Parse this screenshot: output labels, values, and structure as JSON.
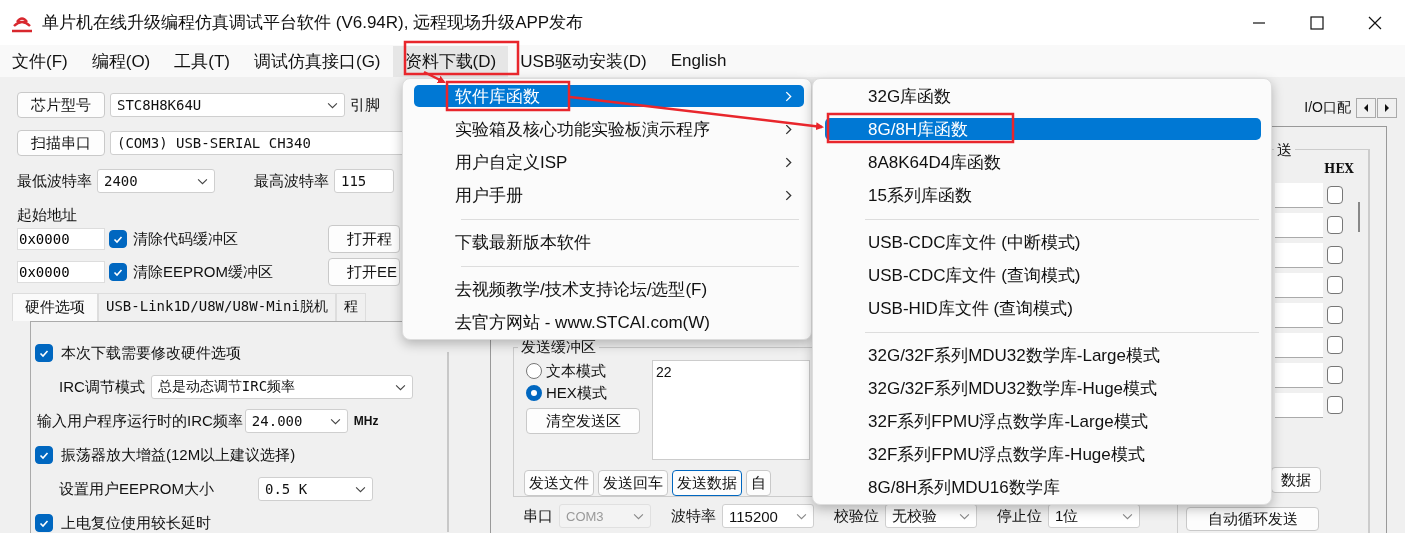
{
  "window": {
    "title": "单片机在线升级编程仿真调试平台软件 (V6.94R), 远程现场升级APP发布"
  },
  "menu_bar": [
    {
      "label": "文件(F)",
      "selected": false
    },
    {
      "label": "编程(O)",
      "selected": false
    },
    {
      "label": "工具(T)",
      "selected": false
    },
    {
      "label": "调试仿真接口(G)",
      "selected": false
    },
    {
      "label": "资料下载(D)",
      "selected": true
    },
    {
      "label": "USB驱动安装(D)",
      "selected": false
    },
    {
      "label": "English",
      "selected": false
    }
  ],
  "chip": {
    "button": "芯片型号",
    "value": "STC8H8K64U",
    "pin_label": "引脚"
  },
  "port": {
    "button": "扫描串口",
    "value": "(COM3) USB-SERIAL CH340"
  },
  "baud": {
    "min_label": "最低波特率",
    "min_value": "2400",
    "max_label": "最高波特率",
    "max_value": "115"
  },
  "start_address": {
    "label": "起始地址",
    "rows": [
      {
        "value": "0x0000",
        "checkbox": "清除代码缓冲区",
        "checked": true,
        "button": "打开程"
      },
      {
        "value": "0x0000",
        "checkbox": "清除EEPROM缓冲区",
        "checked": true,
        "button": "打开EE"
      }
    ]
  },
  "option_tabs": [
    {
      "label": "硬件选项",
      "selected": true
    },
    {
      "label": "USB-Link1D/U8W/U8W-Mini脱机",
      "selected": false
    },
    {
      "label": "程",
      "selected": false
    }
  ],
  "hardware_options": [
    {
      "kind": "checkbox",
      "label": "本次下载需要修改硬件选项",
      "checked": true
    },
    {
      "kind": "select",
      "label": "IRC调节模式",
      "value": "总是动态调节IRC频率"
    },
    {
      "kind": "select",
      "label": "输入用户程序运行时的IRC频率",
      "value": "24.000",
      "unit": "MHz"
    },
    {
      "kind": "checkbox",
      "label": "振荡器放大增益(12M以上建议选择)",
      "checked": true
    },
    {
      "kind": "select",
      "label": "设置用户EEPROM大小",
      "value": "0.5 K"
    },
    {
      "kind": "checkbox",
      "label": "上电复位使用较长延时",
      "checked": true
    }
  ],
  "right_tabs": [
    {
      "label": "I/O口配"
    }
  ],
  "send_buffer": {
    "title": "发送缓冲区",
    "modes": [
      {
        "label": "文本模式",
        "selected": false
      },
      {
        "label": "HEX模式",
        "selected": true
      }
    ],
    "clear_button": "清空发送区",
    "content": "22",
    "buttons": [
      {
        "label": "发送文件",
        "focused": false
      },
      {
        "label": "发送回车",
        "focused": false
      },
      {
        "label": "发送数据",
        "focused": true
      },
      {
        "label": "自",
        "focused": false
      }
    ]
  },
  "serial_settings": [
    {
      "label": "串口",
      "value": "COM3",
      "disabled": true
    },
    {
      "label": "波特率",
      "value": "115200",
      "disabled": false
    },
    {
      "label": "校验位",
      "value": "无校验",
      "disabled": false
    },
    {
      "label": "停止位",
      "value": "1位",
      "disabled": false
    }
  ],
  "multi_send": {
    "title": "送",
    "hex_header": "HEX",
    "rows": [
      {
        "checked": false
      },
      {
        "checked": false
      },
      {
        "checked": false
      },
      {
        "checked": false
      },
      {
        "checked": false
      },
      {
        "checked": false
      },
      {
        "checked": false
      },
      {
        "checked": false
      }
    ],
    "send_button": "数据",
    "auto_button": "自动循环发送"
  },
  "data_menu": [
    {
      "kind": "item",
      "label": "软件库函数",
      "submenu": true,
      "selected": true
    },
    {
      "kind": "item",
      "label": "实验箱及核心功能实验板演示程序",
      "submenu": true,
      "selected": false
    },
    {
      "kind": "item",
      "label": "用户自定义ISP",
      "submenu": true,
      "selected": false
    },
    {
      "kind": "item",
      "label": "用户手册",
      "submenu": true,
      "selected": false
    },
    {
      "kind": "separator"
    },
    {
      "kind": "item",
      "label": "下载最新版本软件",
      "submenu": false,
      "selected": false
    },
    {
      "kind": "separator"
    },
    {
      "kind": "item",
      "label": "去视频教学/技术支持论坛/选型(F)",
      "submenu": false,
      "selected": false
    },
    {
      "kind": "item",
      "label": "去官方网站 - www.STCAI.com(W)",
      "submenu": false,
      "selected": false
    }
  ],
  "library_submenu": [
    {
      "kind": "item",
      "label": "32G库函数",
      "selected": false
    },
    {
      "kind": "item",
      "label": "8G/8H库函数",
      "selected": true
    },
    {
      "kind": "item",
      "label": "8A8K64D4库函数",
      "selected": false
    },
    {
      "kind": "item",
      "label": "15系列库函数",
      "selected": false
    },
    {
      "kind": "separator"
    },
    {
      "kind": "item",
      "label": "USB-CDC库文件 (中断模式)",
      "selected": false
    },
    {
      "kind": "item",
      "label": "USB-CDC库文件 (查询模式)",
      "selected": false
    },
    {
      "kind": "item",
      "label": "USB-HID库文件 (查询模式)",
      "selected": false
    },
    {
      "kind": "separator"
    },
    {
      "kind": "item",
      "label": "32G/32F系列MDU32数学库-Large模式",
      "selected": false
    },
    {
      "kind": "item",
      "label": "32G/32F系列MDU32数学库-Huge模式",
      "selected": false
    },
    {
      "kind": "item",
      "label": "32F系列FPMU浮点数学库-Large模式",
      "selected": false
    },
    {
      "kind": "item",
      "label": "32F系列FPMU浮点数学库-Huge模式",
      "selected": false
    },
    {
      "kind": "item",
      "label": "8G/8H系列MDU16数学库",
      "selected": false
    }
  ]
}
